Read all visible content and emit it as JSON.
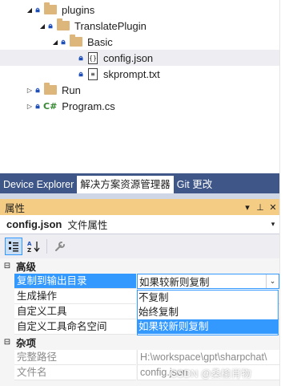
{
  "tree": {
    "items": [
      {
        "label": "plugins",
        "kind": "folder",
        "expander": "◢",
        "locked": true
      },
      {
        "label": "TranslatePlugin",
        "kind": "folder",
        "expander": "◢",
        "locked": true
      },
      {
        "label": "Basic",
        "kind": "folder",
        "expander": "◢",
        "locked": true
      },
      {
        "label": "config.json",
        "kind": "file",
        "file_glyph": "{}",
        "locked": true
      },
      {
        "label": "skprompt.txt",
        "kind": "file",
        "file_glyph": "≡",
        "locked": true
      },
      {
        "label": "Run",
        "kind": "folder",
        "expander": "▷",
        "locked": true
      },
      {
        "label": "Program.cs",
        "kind": "csharp",
        "expander": "▷",
        "locked": true,
        "icon_text": "C#"
      }
    ]
  },
  "tabs": [
    {
      "label": "Device Explorer",
      "active": false
    },
    {
      "label": "解决方案资源管理器",
      "active": true
    },
    {
      "label": "Git 更改",
      "active": false
    }
  ],
  "properties": {
    "title": "属性",
    "title_buttons": {
      "dropdown": "▾",
      "pin": "⊥",
      "close": "✕"
    },
    "object_name": "config.json",
    "object_type": "文件属性",
    "object_dropdown": "▾",
    "categories": [
      {
        "label": "高级",
        "toggle": "⊟",
        "rows": [
          {
            "name": "复制到输出目录",
            "value": "如果较新则复制",
            "selected": true
          },
          {
            "name": "生成操作",
            "value": ""
          },
          {
            "name": "自定义工具",
            "value": ""
          },
          {
            "name": "自定义工具命名空间",
            "value": ""
          }
        ]
      },
      {
        "label": "杂项",
        "toggle": "⊟",
        "rows": [
          {
            "name": "完整路径",
            "value": "H:\\workspace\\gpt\\sharpchat\\",
            "readonly": true
          },
          {
            "name": "文件名",
            "value": "config.json",
            "readonly": true
          }
        ]
      }
    ],
    "dropdown_options": [
      "不复制",
      "始终复制",
      "如果较新则复制"
    ],
    "dropdown_selected": "如果较新则复制"
  },
  "watermark": "CSDN @桑榆肖物",
  "colors": {
    "accent": "#3399ff",
    "tab_strip": "#3e5688",
    "panel_title": "#f5cc84",
    "folder": "#dcb67a",
    "lock": "#1e4fb8"
  }
}
